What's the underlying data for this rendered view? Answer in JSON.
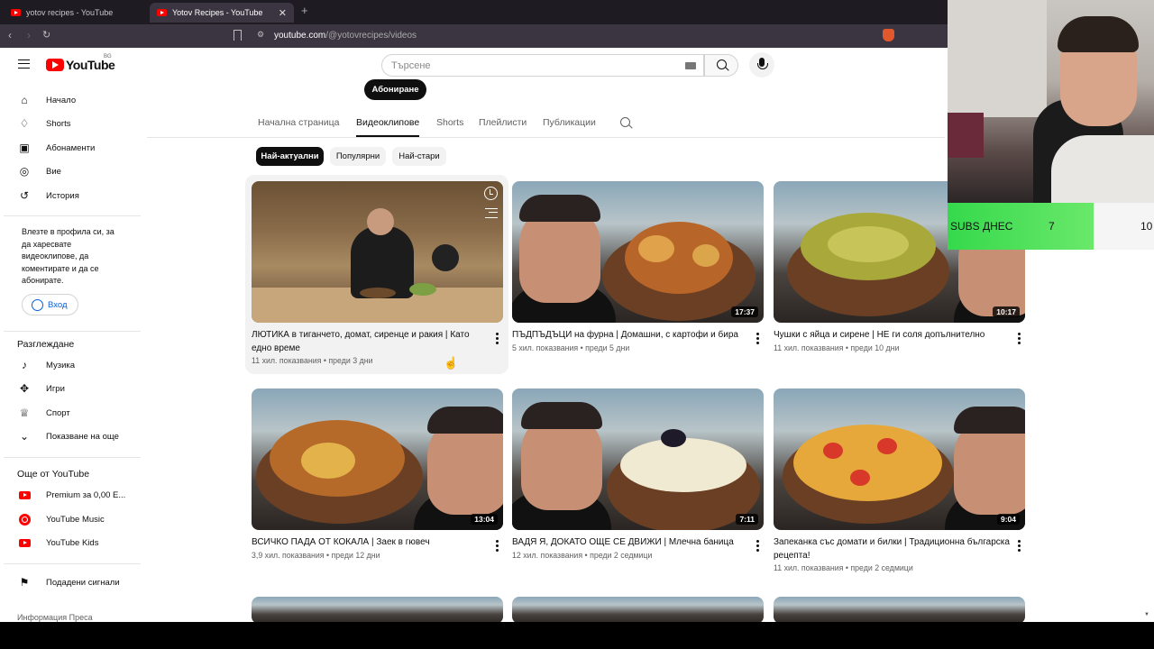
{
  "browser": {
    "tabs": [
      {
        "title": "yotov recipes - YouTube",
        "active": false
      },
      {
        "title": "Yotov Recipes - YouTube",
        "active": true
      }
    ],
    "url_domain": "youtube.com",
    "url_path": "/@yotovrecipes/videos"
  },
  "header": {
    "logo_text": "YouTube",
    "country_code": "BG",
    "search_placeholder": "Търсене"
  },
  "sidebar": {
    "items": [
      {
        "label": "Начало",
        "icon": "home-icon"
      },
      {
        "label": "Shorts",
        "icon": "shorts-icon"
      },
      {
        "label": "Абонаменти",
        "icon": "subscriptions-icon"
      },
      {
        "label": "Вие",
        "icon": "user-icon"
      },
      {
        "label": "История",
        "icon": "history-icon"
      }
    ],
    "signin_prompt": "Влезте в профила си, за да харесвате видеоклипове, да коментирате и да се абонирате.",
    "signin_label": "Вход",
    "explore_heading": "Разглеждане",
    "explore_items": [
      {
        "label": "Музика",
        "icon": "music-icon"
      },
      {
        "label": "Игри",
        "icon": "gaming-icon"
      },
      {
        "label": "Спорт",
        "icon": "trophy-icon"
      },
      {
        "label": "Показване на още",
        "icon": "chevron-down-icon"
      }
    ],
    "more_heading": "Още от YouTube",
    "more_items": [
      {
        "label": "Premium за 0,00 Е...",
        "icon": "youtube-premium-icon"
      },
      {
        "label": "YouTube Music",
        "icon": "youtube-music-icon"
      },
      {
        "label": "YouTube Kids",
        "icon": "youtube-kids-icon"
      }
    ],
    "report_label": "Подадени сигнали",
    "footer": "Информация  Преса"
  },
  "channel": {
    "subscribe_label": "Абониране",
    "tabs": [
      "Начална страница",
      "Видеоклипове",
      "Shorts",
      "Плейлисти",
      "Публикации"
    ],
    "active_tab": "Видеоклипове",
    "chips": [
      "Най-актуални",
      "Популярни",
      "Най-стари"
    ],
    "active_chip": "Най-актуални"
  },
  "videos": [
    {
      "title": "ЛЮТИКА в тиганчето, домат, сиренце и ракия | Като едно време",
      "views": "11 хил. показвания",
      "age": "преди 3 дни",
      "duration": ""
    },
    {
      "title": "ПЪДПЪДЪЦИ на фурна | Домашни, с картофи и бира",
      "views": "5 хил. показвания",
      "age": "преди 5 дни",
      "duration": "17:37"
    },
    {
      "title": "Чушки с яйца и сирене | НЕ ги соля допълнително",
      "views": "11 хил. показвания",
      "age": "преди 10 дни",
      "duration": "10:17"
    },
    {
      "title": "ВСИЧКО ПАДА ОТ КОКАЛА | Заек в гювеч",
      "views": "3,9 хил. показвания",
      "age": "преди 12 дни",
      "duration": "13:04"
    },
    {
      "title": "ВАДЯ Я, ДОКАТО ОЩЕ СЕ ДВИЖИ | Млечна баница",
      "views": "12 хил. показвания",
      "age": "преди 2 седмици",
      "duration": "7:11"
    },
    {
      "title": "Запеканка със домати и билки | Традиционна българска рецепта!",
      "views": "11 хил. показвания",
      "age": "преди 2 седмици",
      "duration": "9:04"
    }
  ],
  "overlay": {
    "subs_label": "SUBS ДНЕС",
    "subs_count": "7",
    "subs_goal": "10"
  },
  "colors": {
    "youtube_red": "#ff0000",
    "link_blue": "#065fd4",
    "subs_green": "#35d94c"
  }
}
